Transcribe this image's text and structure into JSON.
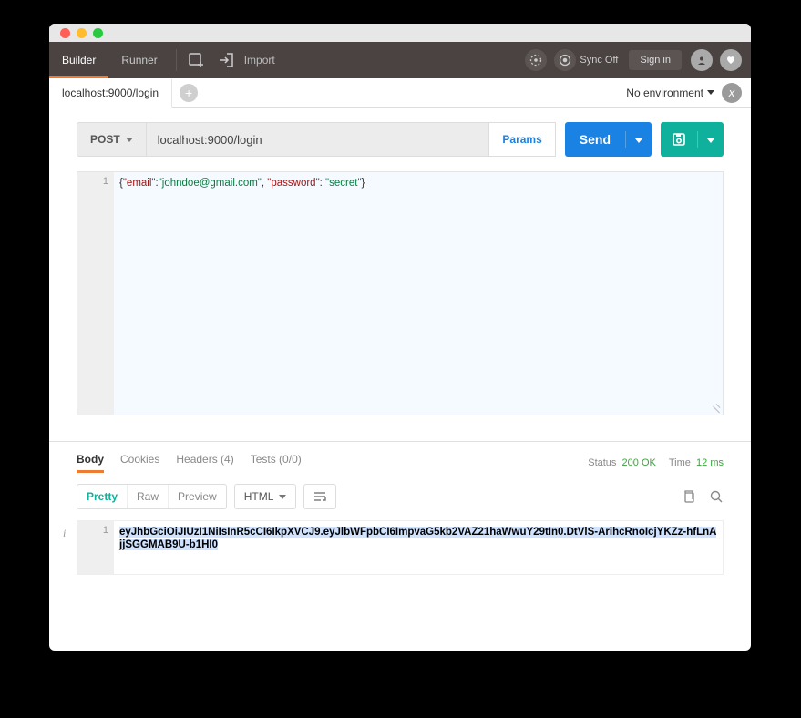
{
  "topbar": {
    "builder": "Builder",
    "runner": "Runner",
    "import": "Import",
    "sync": "Sync Off",
    "signin": "Sign in"
  },
  "tab": {
    "title": "localhost:9000/login"
  },
  "env": {
    "label": "No environment"
  },
  "request": {
    "method": "POST",
    "url": "localhost:9000/login",
    "params": "Params",
    "send": "Send"
  },
  "body_json": {
    "line_no": "1",
    "open": "{",
    "k1": "\"email\"",
    "v1": "\"johndoe@gmail.com\"",
    "sep": ", ",
    "k2": "\"password\"",
    "v2": "\"secret\"",
    "close": "}"
  },
  "resp_tabs": {
    "body": "Body",
    "cookies": "Cookies",
    "headers": "Headers (4)",
    "tests": "Tests (0/0)"
  },
  "status": {
    "status_label": "Status",
    "status_val": "200 OK",
    "time_label": "Time",
    "time_val": "12 ms"
  },
  "view": {
    "pretty": "Pretty",
    "raw": "Raw",
    "preview": "Preview",
    "format": "HTML"
  },
  "response": {
    "line_no": "1",
    "text": "eyJhbGciOiJIUzI1NiIsInR5cCI6IkpXVCJ9.eyJlbWFpbCI6ImpvaG5kb2VAZ21haWwuY29tIn0.DtVlS-ArihcRnoIcjYKZz-hfLnAjjSGGMAB9U-b1HI0"
  }
}
